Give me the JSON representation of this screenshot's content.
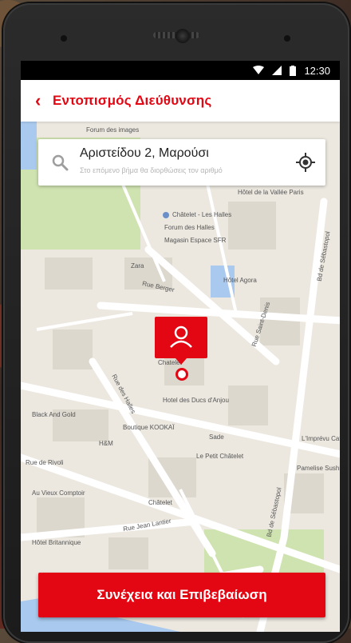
{
  "status_bar": {
    "time": "12:30"
  },
  "app_bar": {
    "title": "Εντοπισμός Διεύθυνσης"
  },
  "search": {
    "value": "Αριστείδου 2, Μαρούσι",
    "hint": "Στο επόμενο βήμα θα διορθώσεις τον αριθμό"
  },
  "map_labels": [
    "Forum des images",
    "Hôtel de la Vallée Paris",
    "Châtelet - Les Halles",
    "Forum des Halles",
    "Magasin Espace SFR",
    "Zara",
    "Rue Berger",
    "Hôtel Agora",
    "Rue Saint-Denis",
    "Unkut Concept Store Chatelet",
    "Hotel des Ducs d'Anjou",
    "Black And Gold",
    "Boutique KOOKAÏ",
    "Sade",
    "L'Imprévu Café",
    "H&M",
    "Le Petit Châtelet",
    "Rue de Rivoli",
    "Au Vieux Comptoir",
    "Châtelet",
    "Rue Jean Lantier",
    "Hôtel Britannique",
    "Pamelise Sushi Bar",
    "Bd de Sébastopol",
    "Rue des Halles",
    "Bd de Sébastopol"
  ],
  "cta": {
    "label": "Συνέχεια και Επιβεβαίωση"
  },
  "colors": {
    "accent": "#e30613",
    "map_bg": "#ece8e0",
    "map_road": "#ffffff",
    "park": "#cfe3b0",
    "water": "#a9c9ee"
  },
  "icons": {
    "back": "chevron-left-icon",
    "search": "search-icon",
    "locate": "my-location-icon",
    "user": "user-icon"
  }
}
